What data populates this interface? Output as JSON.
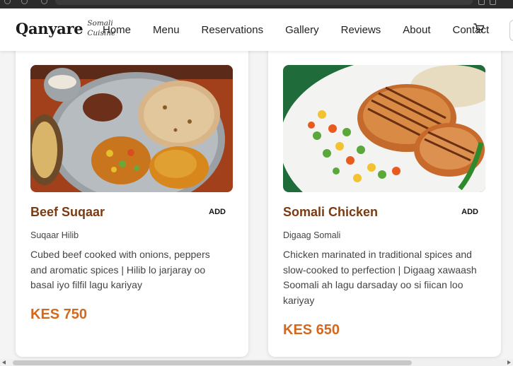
{
  "browser": {
    "url_visible": "(/ecpulse/)"
  },
  "navbar": {
    "logo_main": "Qanyare",
    "logo_sub": "Somali Cuisine",
    "links": [
      "Home",
      "Menu",
      "Reservations",
      "Gallery",
      "Reviews",
      "About",
      "Contact"
    ],
    "cart_icon": "shopping-cart-icon"
  },
  "menu_items": [
    {
      "name": "Beef Suqaar",
      "add_label": "ADD",
      "local_name": "Suqaar Hilib",
      "description": "Cubed beef cooked with onions, peppers and aromatic spices | Hilib lo jarjaray oo basal iyo filfil lagu kariyay",
      "price": "KES 750",
      "image": "beef-suqaar-thali-plate-image"
    },
    {
      "name": "Somali Chicken",
      "add_label": "ADD",
      "local_name": "Digaag Somali",
      "description": "Chicken marinated in traditional spices and slow-cooked to perfection | Digaag xawaash Soomali ah lagu darsaday oo si fiican loo kariyay",
      "price": "KES 650",
      "image": "grilled-chicken-vegetables-image"
    }
  ],
  "colors": {
    "dish_name": "#7a3b12",
    "price": "#d2691e",
    "nav_background": "#ffffff",
    "page_background": "#f4f4f4"
  }
}
